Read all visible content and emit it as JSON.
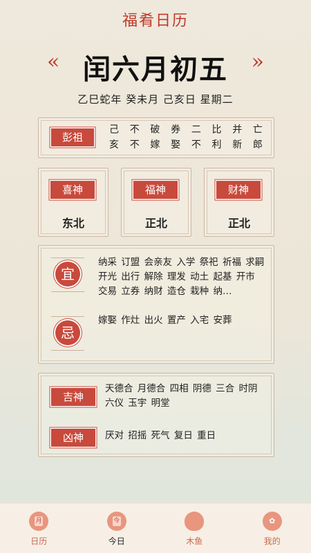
{
  "header": {
    "app_title": "福肴日历",
    "prev_arrow": "«",
    "next_arrow": "»",
    "lunar_date": "闰六月初五",
    "ganzhi_line": "乙巳蛇年  癸未月  己亥日  星期二"
  },
  "pengzu": {
    "label": "彭祖",
    "line1": [
      "己",
      "不",
      "破",
      "券",
      "二",
      "比",
      "并",
      "亡"
    ],
    "line2": [
      "亥",
      "不",
      "嫁",
      "娶",
      "不",
      "利",
      "新",
      "郎"
    ]
  },
  "shen": [
    {
      "label": "喜神",
      "direction": "东北"
    },
    {
      "label": "福神",
      "direction": "正北"
    },
    {
      "label": "财神",
      "direction": "正北"
    }
  ],
  "yiji": {
    "yi_label": "宜",
    "yi_text": "纳采 订盟 会亲友 入学 祭祀 祈福 求嗣 开光 出行 解除 理发 动土 起基 开市 交易 立券 纳财 造仓 栽种 纳…",
    "ji_label": "忌",
    "ji_text": "嫁娶 作灶 出火 置产 入宅 安葬"
  },
  "shensha": {
    "jishen_label": "吉神",
    "jishen_text": "天德合 月德合 四相 阴德 三合 时阴 六仪 玉宇 明堂",
    "xiongshen_label": "凶神",
    "xiongshen_text": "厌对 招摇 死气 复日 重日"
  },
  "tabbar": {
    "items": [
      {
        "label": "日历",
        "icon": "calendar-icon"
      },
      {
        "label": "今日",
        "icon": "today-icon"
      },
      {
        "label": "木鱼",
        "icon": "woodfish-icon"
      },
      {
        "label": "我的",
        "icon": "lotus-icon"
      }
    ]
  },
  "colors": {
    "accent_red": "#c84a3c",
    "tab_icon": "#e8967e"
  }
}
